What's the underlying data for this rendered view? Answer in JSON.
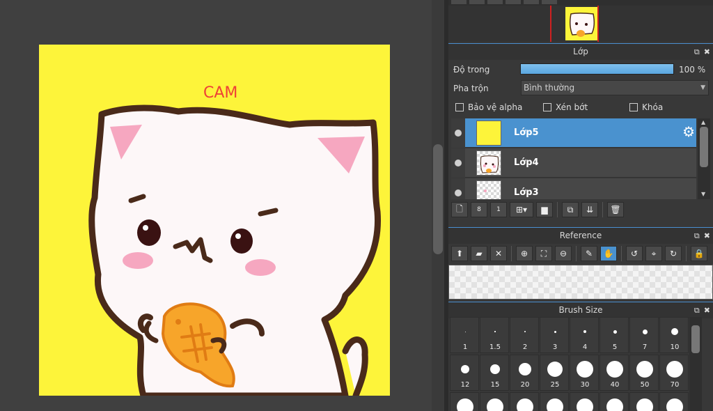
{
  "canvas": {
    "text": "CAM",
    "bg_color": "#fdf43a"
  },
  "layer_panel": {
    "title": "Lớp",
    "opacity_label": "Độ trong",
    "opacity_value": "100 %",
    "opacity_percent": 100,
    "blend_label": "Pha trộn",
    "blend_value": "Bình thường",
    "checkboxes": {
      "alpha": "Bảo vệ alpha",
      "clip": "Xén bớt",
      "lock": "Khóa"
    },
    "layers": [
      {
        "name": "Lớp5",
        "selected": true
      },
      {
        "name": "Lớp4",
        "selected": false
      },
      {
        "name": "Lớp3",
        "selected": false
      }
    ]
  },
  "reference_panel": {
    "title": "Reference"
  },
  "brush_panel": {
    "title": "Brush Size",
    "sizes": [
      "1",
      "1.5",
      "2",
      "3",
      "4",
      "5",
      "7",
      "10",
      "12",
      "15",
      "20",
      "25",
      "30",
      "40",
      "50",
      "70"
    ]
  },
  "colors": {
    "accent": "#4a92cf",
    "canvas": "#fdf43a"
  }
}
